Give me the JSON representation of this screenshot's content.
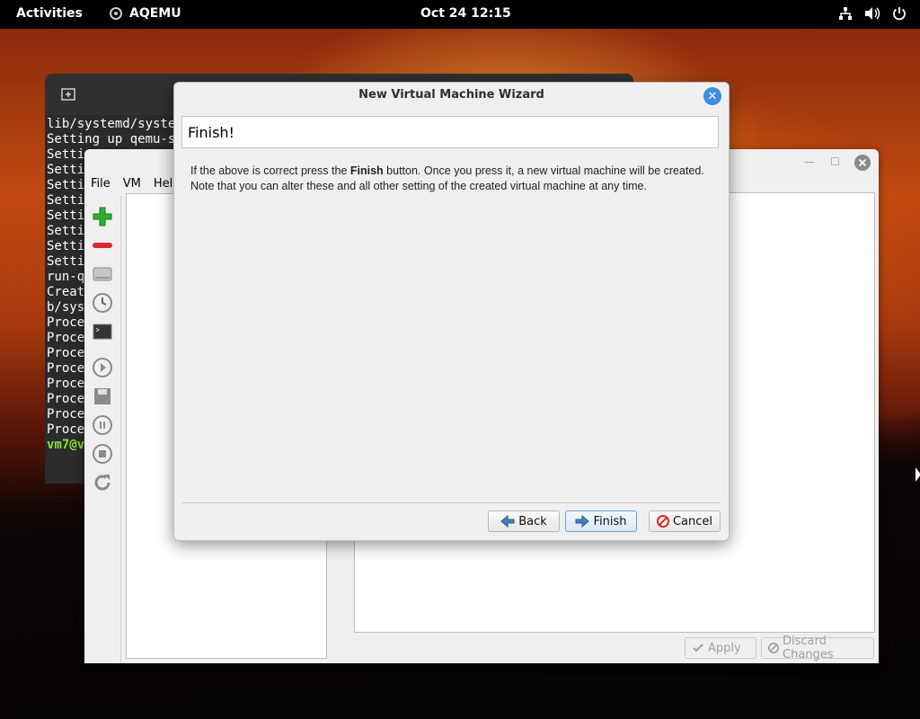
{
  "topbar": {
    "activities": "Activities",
    "app_name": "AQEMU",
    "clock": "Oct 24  12:15"
  },
  "terminal": {
    "lines": [
      "lib/systemd/system",
      "Setting up qemu-sy",
      "Settin",
      "Settin",
      "Settin",
      "Settin",
      "Settin",
      "Settin",
      "Settin",
      "Settin",
      "run-qe",
      "Create",
      "b/syst",
      "Proces",
      "Proces",
      "Proces",
      "Proces",
      "Proces",
      "Proces",
      "Proces",
      "Proces"
    ],
    "prompt": "vm7@vm"
  },
  "aqemu": {
    "menu": {
      "file": "File",
      "vm": "VM",
      "help": "Hel"
    },
    "apply": "Apply",
    "discard": "Discard Changes"
  },
  "wizard": {
    "title": "New Virtual Machine Wizard",
    "page_title": "Finish!",
    "body": {
      "p1_pre": "If the above is correct press the ",
      "p1_bold": "Finish",
      "p1_post": " button. Once you press it, a new virtual machine will be created.",
      "p2": "Note that you can alter these and all other setting of the created virtual machine at any time."
    },
    "buttons": {
      "back": "Back",
      "finish": "Finish",
      "cancel": "Cancel"
    }
  },
  "colors": {
    "accent": "#3d8fe0",
    "prompt_green": "#8ae234"
  }
}
